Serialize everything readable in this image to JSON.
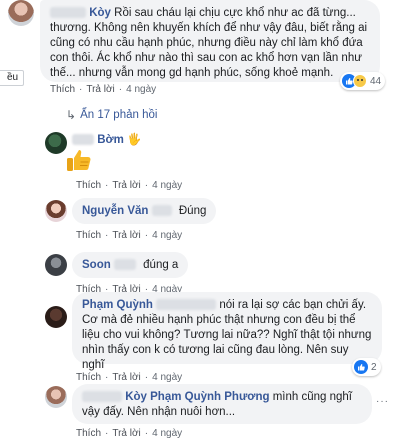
{
  "side_fragment": "ều",
  "comments": [
    {
      "id": "c1",
      "author": "Kòy",
      "text": "Rồi sau cháu lại chịu cực khổ như ac đã từng... thương. Không nên khuyến khích để như vậy đâu, biết rằng ai cũng có nhu cầu hạnh phúc, nhưng điều này chỉ làm khổ đứa con thôi. Ác khổ như nào thì sau con ac khổ hơn vạn lần như thế... nhưng vẫn mong gd hạnh phúc, sống khoẻ mạnh.",
      "actions": {
        "like": "Thích",
        "reply": "Trả lời",
        "time": "4 ngày"
      },
      "reactions": {
        "count": "44",
        "icons": [
          "like-icon",
          "sad-icon"
        ]
      },
      "replies_link": "Ẩn 17 phản hồi"
    }
  ],
  "replies": [
    {
      "id": "r1",
      "author": "Bờm",
      "author_suffix": "🖐",
      "sticker": "thumbs-up-icon",
      "actions": {
        "like": "Thích",
        "reply": "Trả lời",
        "time": "4 ngày"
      }
    },
    {
      "id": "r2",
      "author": "Nguyễn Văn",
      "text": "Đúng",
      "actions": {
        "like": "Thích",
        "reply": "Trả lời",
        "time": "4 ngày"
      }
    },
    {
      "id": "r3",
      "author": "Soon",
      "text": "đúng a",
      "actions": {
        "like": "Thích",
        "reply": "Trả lời",
        "time": "4 ngày"
      }
    },
    {
      "id": "r4",
      "author": "Phạm Quỳnh",
      "text_first": "nói ra lại sợ các bạn chửi ấy. Cơ mà",
      "text_rest": "đẻ nhiều hạnh phúc thật nhưng con đều bị thể liệu cho vui không? Tương lai nữa?? Nghĩ thật tội nhưng nhìn thấy con k có tương lai cũng đau lòng. Nên suy nghĩ",
      "actions": {
        "like": "Thích",
        "reply": "Trả lời",
        "time": "4 ngày"
      },
      "reactions": {
        "count": "2",
        "icons": [
          "like-icon"
        ]
      }
    },
    {
      "id": "r5",
      "author": "Kòy",
      "mention": "Phạm Quỳnh Phương",
      "text": "mình cũng nghĩ vậy đấy. Nên nhận nuôi hơn...",
      "actions": {
        "like": "Thích",
        "reply": "Trả lời",
        "time": "4 ngày"
      }
    }
  ],
  "colors": {
    "author": "#385898",
    "bubble": "#f2f3f5",
    "like": "#1877f2",
    "sad": "#f7c948",
    "meta": "#606770"
  }
}
